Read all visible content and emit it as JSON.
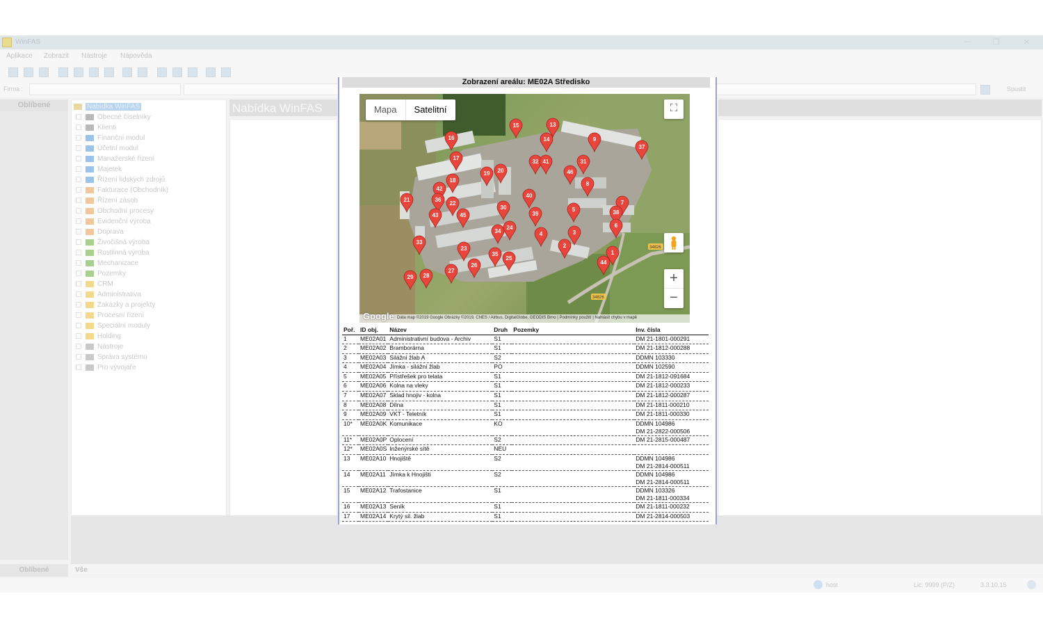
{
  "app": {
    "title": "WinFAS",
    "logo_letter": "W",
    "menu": [
      "Aplikace",
      "Zobrazit",
      "Nástroje",
      "Nápověda"
    ],
    "firma_label": "Firma :",
    "spust_label": "Spustit",
    "favorites_label": "Oblíbené",
    "tree_root": "Nabídka WinFAS",
    "tree_items": [
      {
        "label": "Obecné číselníky",
        "color": "#b9b9b9"
      },
      {
        "label": "Klienti",
        "color": "#b9b9b9"
      },
      {
        "label": "Finanční modul",
        "color": "#9cc3ea"
      },
      {
        "label": "Účetní modul",
        "color": "#9cc3ea"
      },
      {
        "label": "Manažerské řízení",
        "color": "#9cc3ea"
      },
      {
        "label": "Majetek",
        "color": "#9cc3ea"
      },
      {
        "label": "Řízení lidských zdrojů",
        "color": "#9cc3ea"
      },
      {
        "label": "Fakturace (Obchodník)",
        "color": "#f2c79b"
      },
      {
        "label": "Řízení zásob",
        "color": "#f2c79b"
      },
      {
        "label": "Obchodní procesy",
        "color": "#f2c79b"
      },
      {
        "label": "Evidenční výroba",
        "color": "#f2c79b"
      },
      {
        "label": "Doprava",
        "color": "#f2c79b"
      },
      {
        "label": "Živočišná výroba",
        "color": "#a9d08e"
      },
      {
        "label": "Rostlinná výroba",
        "color": "#a9d08e"
      },
      {
        "label": "Mechanizace",
        "color": "#a9d08e"
      },
      {
        "label": "Pozemky",
        "color": "#a9d08e"
      },
      {
        "label": "CRM",
        "color": "#f5d98a"
      },
      {
        "label": "Administrativa",
        "color": "#f5d98a"
      },
      {
        "label": "Zakázky a projekty",
        "color": "#f5d98a"
      },
      {
        "label": "Procesní řízení",
        "color": "#f5d98a"
      },
      {
        "label": "Speciální moduly",
        "color": "#f5d98a"
      },
      {
        "label": "Holding",
        "color": "#f5d98a"
      },
      {
        "label": "Nástroje",
        "color": "#c9c9c9"
      },
      {
        "label": "Správa systému",
        "color": "#c9c9c9"
      },
      {
        "label": "Pro vývojáře",
        "color": "#c9c9c9"
      }
    ],
    "content_title": "Nabídka WinFAS",
    "bottom_tab_favorites": "Oblíbené",
    "bottom_tab_all": "Vše",
    "status_user": "host",
    "status_lic": "Lic: 9999 (P/Z)",
    "status_version": "3.3.10.15"
  },
  "dialog": {
    "title": "Zobrazení areálu: ME02A Středisko",
    "map": {
      "type_map": "Mapa",
      "type_satellite": "Satelitní",
      "attribution": "Data map ©2019 Google Obrázky ©2019, CNES / Airbus, DigitalGlobe, GEODIS Brno  |  Podmínky použití  |  Nahlásit chybu v mapě",
      "google_label": "Google",
      "zoom_in": "+",
      "zoom_out": "−",
      "fullscreen_icon": "fullscreen-icon",
      "pegman_icon": "pegman-icon",
      "road_labels": [
        "34826",
        "34826"
      ],
      "markers": [
        "15",
        "13",
        "16",
        "14",
        "9",
        "37",
        "17",
        "32",
        "41",
        "31",
        "18",
        "19",
        "20",
        "46",
        "8",
        "42",
        "21",
        "36",
        "22",
        "40",
        "7",
        "43",
        "45",
        "30",
        "39",
        "5",
        "38",
        "6",
        "34",
        "24",
        "3",
        "4",
        "33",
        "2",
        "1",
        "23",
        "35",
        "25",
        "44",
        "29",
        "28",
        "27",
        "26"
      ]
    },
    "table": {
      "headers": [
        "Poř.",
        "ID obj.",
        "Název",
        "Druh",
        "Pozemky",
        "Inv. čísla"
      ],
      "rows": [
        {
          "por": "1",
          "id": "ME02A01",
          "nazev": "Administrativní budova - Archiv",
          "druh": "S1",
          "pozemky": "",
          "inv": "DM 21-1801-000291"
        },
        {
          "por": "2",
          "id": "ME02A02",
          "nazev": "Bramborárna",
          "druh": "S1",
          "pozemky": "",
          "inv": "DM 21-1812-000288"
        },
        {
          "por": "3",
          "id": "ME02A03",
          "nazev": "Silážní žlab A",
          "druh": "S2",
          "pozemky": "",
          "inv": "DDMN 103330"
        },
        {
          "por": "4",
          "id": "ME02A04",
          "nazev": "Jímka - silážní žlab",
          "druh": "PO",
          "pozemky": "",
          "inv": "DDMN 102590"
        },
        {
          "por": "5",
          "id": "ME02A05",
          "nazev": "Přístřešek pro telata",
          "druh": "S1",
          "pozemky": "",
          "inv": "DM 21-1812-091684"
        },
        {
          "por": "6",
          "id": "ME02A06",
          "nazev": "Kolna na vleky",
          "druh": "S1",
          "pozemky": "",
          "inv": "DM 21-1812-000233"
        },
        {
          "por": "7",
          "id": "ME02A07",
          "nazev": "Sklad hnojiv - kolna",
          "druh": "S1",
          "pozemky": "",
          "inv": "DM 21-1812-000287"
        },
        {
          "por": "8",
          "id": "ME02A08",
          "nazev": "Dílna",
          "druh": "S1",
          "pozemky": "",
          "inv": "DM 21-1811-000210"
        },
        {
          "por": "9",
          "id": "ME02A09",
          "nazev": "VKT - Teletník",
          "druh": "S1",
          "pozemky": "",
          "inv": "DM 21-1811-000330"
        },
        {
          "por": "10*",
          "id": "ME02A0K",
          "nazev": "Komunikace",
          "druh": "KO",
          "pozemky": "",
          "inv": "DDMN 104986",
          "inv2": "DM 21-2822-000506"
        },
        {
          "por": "11*",
          "id": "ME02A0P",
          "nazev": "Oplocení",
          "druh": "S2",
          "pozemky": "",
          "inv": "DM 21-2815-000487"
        },
        {
          "por": "12*",
          "id": "ME02A0S",
          "nazev": "Inženýrské sítě",
          "druh": "NEU",
          "pozemky": "",
          "inv": ""
        },
        {
          "por": "13",
          "id": "ME02A10",
          "nazev": "Hnojiště",
          "druh": "S2",
          "pozemky": "",
          "inv": "DDMN 104986",
          "inv2": "DM 21-2814-000511"
        },
        {
          "por": "14",
          "id": "ME02A11",
          "nazev": "Jímka k Hnojišti",
          "druh": "S2",
          "pozemky": "",
          "inv": "DDMN 104986",
          "inv2": "DM 21-2814-000511"
        },
        {
          "por": "15",
          "id": "ME02A12",
          "nazev": "Trafostanice",
          "druh": "S1",
          "pozemky": "",
          "inv": "DDMN 103326",
          "inv2": "DM 21-1811-000334"
        },
        {
          "por": "16",
          "id": "ME02A13",
          "nazev": "Seník",
          "druh": "S1",
          "pozemky": "",
          "inv": "DM 21-1811-000232"
        },
        {
          "por": "17",
          "id": "ME02A14",
          "nazev": "Krytý sil. žlab",
          "druh": "S1",
          "pozemky": "",
          "inv": "DM 21-2814-000503"
        }
      ]
    }
  }
}
